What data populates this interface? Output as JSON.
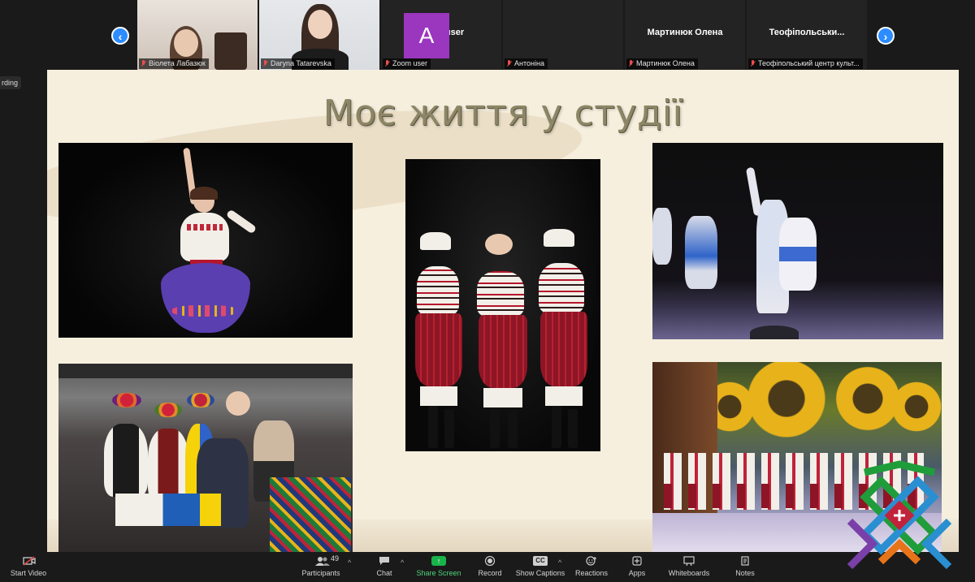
{
  "recording": {
    "label": "rding"
  },
  "participants_strip": {
    "tiles": [
      {
        "caption": "Віолета Лабазюк",
        "type": "video"
      },
      {
        "caption": "Daryna Tatarevska",
        "type": "video"
      },
      {
        "caption": "Zoom user",
        "display_name": "Zoom user",
        "type": "name"
      },
      {
        "caption": "Антоніна",
        "avatar_letter": "A",
        "type": "avatar"
      },
      {
        "caption": "Мартинюк Олена",
        "display_name": "Мартинюк Олена",
        "type": "name"
      },
      {
        "caption": "Теофіпольський центр культ...",
        "display_name": "Теофіпольськи...",
        "type": "name"
      }
    ],
    "nav_prev": "‹",
    "nav_next": "›"
  },
  "slide": {
    "title": "Моє життя у студії"
  },
  "toolbar": {
    "start_video": "Start Video",
    "participants": "Participants",
    "participants_count": "49",
    "chat": "Chat",
    "share_screen": "Share Screen",
    "record": "Record",
    "show_captions": "Show Captions",
    "captions_icon_text": "CC",
    "reactions": "Reactions",
    "apps": "Apps",
    "whiteboards": "Whiteboards",
    "notes": "Notes"
  },
  "colors": {
    "accent_blue": "#2d8cff",
    "avatar_purple": "#9b36bf",
    "share_green": "#19b34b",
    "slide_bg": "#f6efde",
    "title_color": "#8d8666"
  }
}
